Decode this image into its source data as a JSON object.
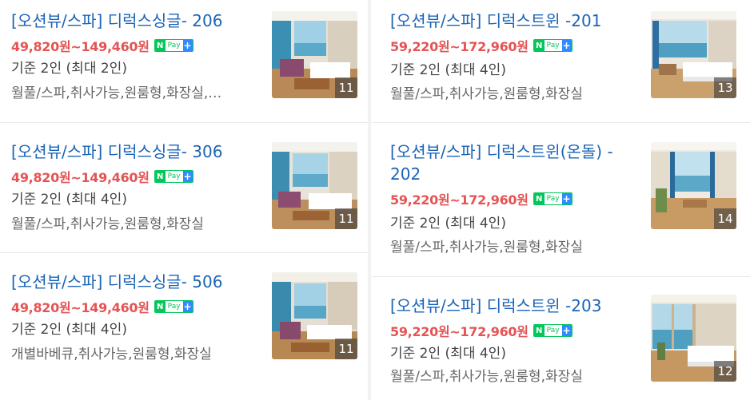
{
  "listings": [
    {
      "title": "[오션뷰/스파] 디럭스싱글- 206",
      "price": "49,820원~149,460원",
      "capacity": "기준 2인 (최대 2인)",
      "amenities": "월풀/스파,취사가능,원룸형,화장실,…",
      "photo_count": "11"
    },
    {
      "title": "[오션뷰/스파] 디럭스싱글- 306",
      "price": "49,820원~149,460원",
      "capacity": "기준 2인 (최대 4인)",
      "amenities": "월풀/스파,취사가능,원룸형,화장실",
      "photo_count": "11"
    },
    {
      "title": "[오션뷰/스파] 디럭스싱글- 506",
      "price": "49,820원~149,460원",
      "capacity": "기준 2인 (최대 4인)",
      "amenities": "개별바베큐,취사가능,원룸형,화장실",
      "photo_count": "11"
    },
    {
      "title": "[오션뷰/스파] 디럭스트윈 -201",
      "price": "59,220원~172,960원",
      "capacity": "기준 2인 (최대 4인)",
      "amenities": "월풀/스파,취사가능,원룸형,화장실",
      "photo_count": "13"
    },
    {
      "title": "[오션뷰/스파] 디럭스트윈(온돌) - 202",
      "price": "59,220원~172,960원",
      "capacity": "기준 2인 (최대 4인)",
      "amenities": "월풀/스파,취사가능,원룸형,화장실",
      "photo_count": "14"
    },
    {
      "title": "[오션뷰/스파] 디럭스트윈 -203",
      "price": "59,220원~172,960원",
      "capacity": "기준 2인 (최대 4인)",
      "amenities": "월풀/스파,취사가능,원룸형,화장실",
      "photo_count": "12"
    }
  ],
  "npay": {
    "n": "N",
    "pay": "Pay",
    "plus": "+"
  },
  "colors": {
    "title": "#1b64b6",
    "price": "#e45454",
    "npay_green": "#04c75a",
    "npay_blue": "#2d8cff"
  }
}
